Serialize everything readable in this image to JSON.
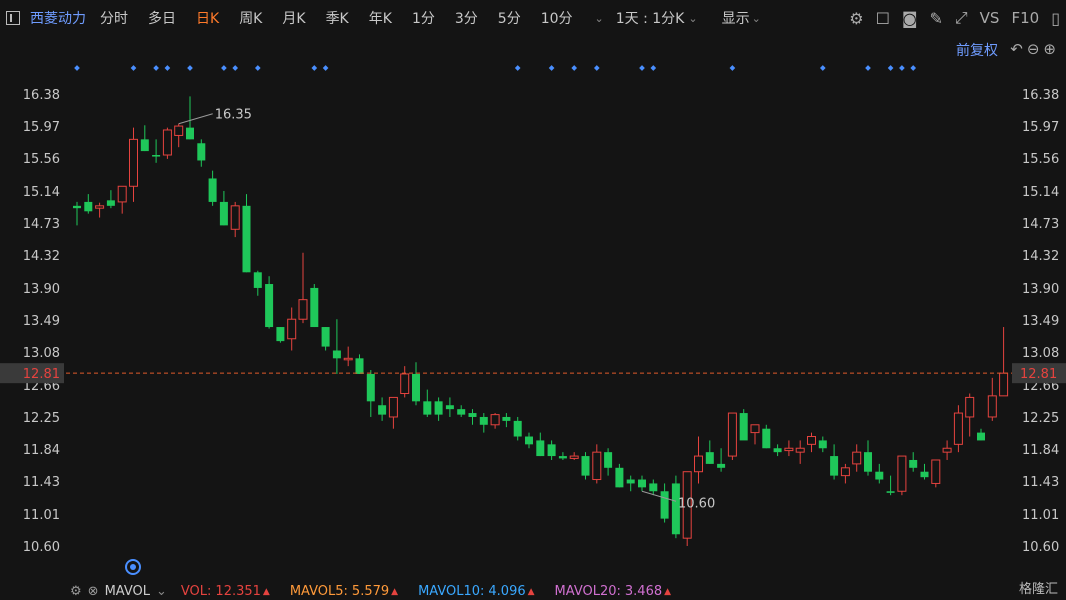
{
  "toolbar": {
    "stock_name": "西菱动力",
    "periods": [
      "分时",
      "多日",
      "日K",
      "周K",
      "月K",
      "季K",
      "年K",
      "1分",
      "3分",
      "5分",
      "10分"
    ],
    "active_period": "日K",
    "interval_selector": "1天 : 1分K",
    "display_label": "显示",
    "vs_label": "VS",
    "f10_label": "F10"
  },
  "adjust_label": "前复权",
  "indicator": {
    "name": "MAVOL",
    "vol_label": "VOL:",
    "vol_value": "12.351",
    "ma5_label": "MAVOL5:",
    "ma5_value": "5.579",
    "ma10_label": "MAVOL10:",
    "ma10_value": "4.096",
    "ma20_label": "MAVOL20:",
    "ma20_value": "3.468"
  },
  "watermark": "格隆汇",
  "colors": {
    "up": "#e5433f",
    "down": "#1fc75a",
    "accent": "#ff7a2a",
    "link": "#6f9cff",
    "current": "#e05a2a",
    "ma5": "#ff9a3a",
    "ma10": "#3aa8ff",
    "ma20": "#d070d0"
  },
  "chart_data": {
    "type": "candlestick",
    "y_ticks": [
      "16.38",
      "15.97",
      "15.56",
      "15.14",
      "14.73",
      "14.32",
      "13.90",
      "13.49",
      "13.08",
      "12.66",
      "12.25",
      "11.84",
      "11.43",
      "11.01",
      "10.60"
    ],
    "ylim": [
      10.6,
      16.38
    ],
    "current_price": "12.81",
    "high_label": "16.35",
    "low_label": "10.60",
    "high_index": 9,
    "low_index": 50,
    "marker_indices": [
      0,
      5,
      7,
      8,
      10,
      13,
      14,
      16,
      21,
      22,
      39,
      42,
      44,
      46,
      50,
      51,
      58,
      66,
      70,
      72,
      73,
      74
    ],
    "candles": [
      [
        14.95,
        15.0,
        14.7,
        14.92
      ],
      [
        15.0,
        15.1,
        14.85,
        14.88
      ],
      [
        14.92,
        14.99,
        14.8,
        14.95
      ],
      [
        15.02,
        15.15,
        14.92,
        14.95
      ],
      [
        15.0,
        15.2,
        14.85,
        15.2
      ],
      [
        15.2,
        15.95,
        15.0,
        15.8
      ],
      [
        15.8,
        15.98,
        15.65,
        15.65
      ],
      [
        15.6,
        15.8,
        15.5,
        15.58
      ],
      [
        15.6,
        15.95,
        15.55,
        15.92
      ],
      [
        15.85,
        16.0,
        15.7,
        15.97
      ],
      [
        15.95,
        16.35,
        15.8,
        15.8
      ],
      [
        15.75,
        15.8,
        15.45,
        15.53
      ],
      [
        15.3,
        15.4,
        14.95,
        15.0
      ],
      [
        15.0,
        15.14,
        14.7,
        14.7
      ],
      [
        14.65,
        15.0,
        14.55,
        14.95
      ],
      [
        14.95,
        15.1,
        14.1,
        14.1
      ],
      [
        14.1,
        14.12,
        13.8,
        13.9
      ],
      [
        13.95,
        14.05,
        13.38,
        13.4
      ],
      [
        13.4,
        13.4,
        13.2,
        13.22
      ],
      [
        13.25,
        13.65,
        13.1,
        13.5
      ],
      [
        13.5,
        14.35,
        13.45,
        13.75
      ],
      [
        13.9,
        13.95,
        13.4,
        13.4
      ],
      [
        13.4,
        13.4,
        13.1,
        13.15
      ],
      [
        13.1,
        13.5,
        12.8,
        13.0
      ],
      [
        13.0,
        13.15,
        12.9,
        13.0
      ],
      [
        13.0,
        13.05,
        12.8,
        12.8
      ],
      [
        12.8,
        12.85,
        12.25,
        12.45
      ],
      [
        12.4,
        12.5,
        12.2,
        12.28
      ],
      [
        12.25,
        12.5,
        12.1,
        12.5
      ],
      [
        12.55,
        12.9,
        12.5,
        12.8
      ],
      [
        12.8,
        12.95,
        12.4,
        12.45
      ],
      [
        12.45,
        12.6,
        12.25,
        12.28
      ],
      [
        12.45,
        12.5,
        12.2,
        12.28
      ],
      [
        12.4,
        12.5,
        12.25,
        12.35
      ],
      [
        12.35,
        12.4,
        12.25,
        12.28
      ],
      [
        12.3,
        12.35,
        12.15,
        12.25
      ],
      [
        12.25,
        12.3,
        12.05,
        12.15
      ],
      [
        12.15,
        12.3,
        12.1,
        12.28
      ],
      [
        12.25,
        12.3,
        12.12,
        12.2
      ],
      [
        12.2,
        12.25,
        11.95,
        12.0
      ],
      [
        12.0,
        12.05,
        11.85,
        11.9
      ],
      [
        11.95,
        12.05,
        11.75,
        11.75
      ],
      [
        11.9,
        11.95,
        11.7,
        11.75
      ],
      [
        11.75,
        11.8,
        11.7,
        11.72
      ],
      [
        11.72,
        11.8,
        11.7,
        11.75
      ],
      [
        11.75,
        11.8,
        11.45,
        11.5
      ],
      [
        11.45,
        11.9,
        11.4,
        11.8
      ],
      [
        11.8,
        11.85,
        11.5,
        11.6
      ],
      [
        11.6,
        11.65,
        11.35,
        11.35
      ],
      [
        11.45,
        11.5,
        11.3,
        11.4
      ],
      [
        11.45,
        11.5,
        11.3,
        11.35
      ],
      [
        11.4,
        11.45,
        11.25,
        11.3
      ],
      [
        11.3,
        11.4,
        10.9,
        10.95
      ],
      [
        11.4,
        11.5,
        10.7,
        10.75
      ],
      [
        10.7,
        11.55,
        10.6,
        11.55
      ],
      [
        11.55,
        12.0,
        11.4,
        11.75
      ],
      [
        11.8,
        11.95,
        11.65,
        11.65
      ],
      [
        11.65,
        11.85,
        11.55,
        11.6
      ],
      [
        11.75,
        12.3,
        11.7,
        12.3
      ],
      [
        12.3,
        12.35,
        12.05,
        11.95
      ],
      [
        12.05,
        12.1,
        11.9,
        12.15
      ],
      [
        12.1,
        12.15,
        11.85,
        11.85
      ],
      [
        11.85,
        11.9,
        11.75,
        11.8
      ],
      [
        11.82,
        11.95,
        11.75,
        11.85
      ],
      [
        11.8,
        11.95,
        11.65,
        11.85
      ],
      [
        11.9,
        12.05,
        11.8,
        12.0
      ],
      [
        11.95,
        12.0,
        11.8,
        11.85
      ],
      [
        11.75,
        11.9,
        11.45,
        11.5
      ],
      [
        11.5,
        11.65,
        11.4,
        11.6
      ],
      [
        11.65,
        11.9,
        11.55,
        11.8
      ],
      [
        11.8,
        11.95,
        11.5,
        11.55
      ],
      [
        11.55,
        11.65,
        11.4,
        11.45
      ],
      [
        11.3,
        11.5,
        11.25,
        11.28
      ],
      [
        11.3,
        11.75,
        11.25,
        11.75
      ],
      [
        11.7,
        11.8,
        11.55,
        11.6
      ],
      [
        11.55,
        11.65,
        11.45,
        11.48
      ],
      [
        11.4,
        11.7,
        11.35,
        11.7
      ],
      [
        11.8,
        11.95,
        11.7,
        11.85
      ],
      [
        11.9,
        12.4,
        11.8,
        12.3
      ],
      [
        12.25,
        12.55,
        12.0,
        12.5
      ],
      [
        12.05,
        12.1,
        11.95,
        11.95
      ],
      [
        12.25,
        12.75,
        12.2,
        12.52
      ],
      [
        12.52,
        13.4,
        12.52,
        12.81
      ]
    ]
  }
}
